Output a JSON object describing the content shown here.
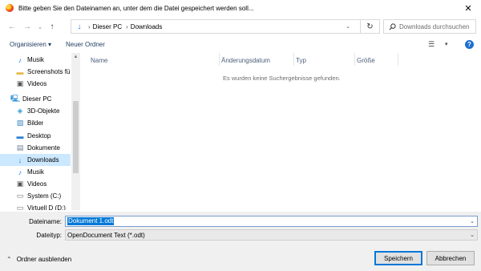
{
  "window": {
    "title": "Bitte geben Sie den Dateinamen an, unter dem die Datei gespeichert werden soll...",
    "close_glyph": "✕"
  },
  "navigation": {
    "back_glyph": "←",
    "forward_glyph": "→",
    "recent_glyph": "⌄",
    "up_glyph": "↑",
    "breadcrumb": [
      "Dieser PC",
      "Downloads"
    ],
    "separator": "›",
    "refresh_glyph": "↻"
  },
  "search": {
    "placeholder": "Downloads durchsuchen"
  },
  "toolbar": {
    "organize_label": "Organisieren ▾",
    "new_folder_label": "Neuer Ordner",
    "view_glyph": "☰",
    "view_drop_glyph": "▾",
    "help_glyph": "?"
  },
  "sidebar": {
    "items": [
      {
        "label": "Musik",
        "icon": "music-icon",
        "glyph": "♪",
        "color": "#1c7ed6"
      },
      {
        "label": "Screenshots für ’",
        "icon": "folder-icon",
        "glyph": "▬",
        "color": "#e8b84a"
      },
      {
        "label": "Videos",
        "icon": "video-icon",
        "glyph": "▣",
        "color": "#555555"
      },
      {
        "label": "Dieser PC",
        "icon": "computer-icon",
        "glyph": "🖳",
        "color": "#2a8fd8"
      },
      {
        "label": "3D-Objekte",
        "icon": "cube-icon",
        "glyph": "◈",
        "color": "#3c9bd6"
      },
      {
        "label": "Bilder",
        "icon": "pictures-icon",
        "glyph": "▨",
        "color": "#3d86c6"
      },
      {
        "label": "Desktop",
        "icon": "desktop-icon",
        "glyph": "▬",
        "color": "#2f7fcf"
      },
      {
        "label": "Dokumente",
        "icon": "documents-icon",
        "glyph": "▤",
        "color": "#6d7f93"
      },
      {
        "label": "Downloads",
        "icon": "download-icon",
        "glyph": "↓",
        "color": "#1c7ed6"
      },
      {
        "label": "Musik",
        "icon": "music-icon",
        "glyph": "♪",
        "color": "#1c7ed6"
      },
      {
        "label": "Videos",
        "icon": "video-icon",
        "glyph": "▣",
        "color": "#555555"
      },
      {
        "label": "System (C:)",
        "icon": "drive-icon",
        "glyph": "▭",
        "color": "#6d6d6d"
      },
      {
        "label": "Virtuell D (D:)",
        "icon": "drive-icon",
        "glyph": "▭",
        "color": "#6d6d6d"
      }
    ],
    "selected_index": 8
  },
  "columns": [
    "Name",
    "Änderungsdatum",
    "Typ",
    "Größe"
  ],
  "empty_message": "Es wurden keine Suchergebnisse gefunden.",
  "form": {
    "filename_label": "Dateiname:",
    "filename_value": "Dokument 1.odt",
    "filetype_label": "Dateityp:",
    "filetype_value": "OpenDocument Text (*.odt)",
    "drop_glyph": "⌄"
  },
  "footer": {
    "hide_folders_glyph": "⌃",
    "hide_folders_label": "Ordner ausblenden",
    "save_label": "Speichern",
    "cancel_label": "Abbrechen"
  },
  "colors": {
    "accent": "#0078d7",
    "selected_row": "#cce8ff"
  }
}
